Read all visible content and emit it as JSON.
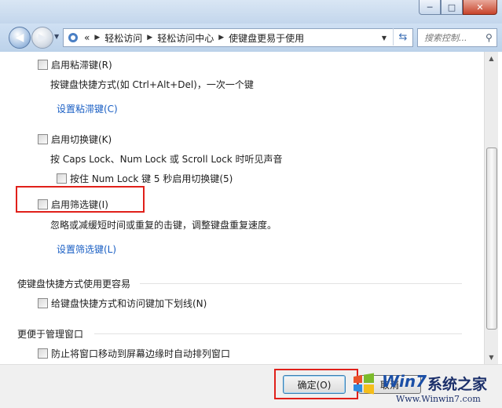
{
  "window": {
    "minimize": "─",
    "maximize": "□",
    "close": "✕"
  },
  "nav": {
    "back_icon": "back-arrow-icon",
    "forward_icon": "forward-arrow-icon",
    "address": {
      "overflow": "«",
      "crumbs": [
        "轻松访问",
        "轻松访问中心",
        "使键盘更易于使用"
      ]
    },
    "search_placeholder": "搜索控制...",
    "refresh_icon": "refresh-icon",
    "search_icon": "magnifier-icon"
  },
  "options": {
    "sticky": {
      "label": "启用粘滞键(R)",
      "desc": "按键盘快捷方式(如 Ctrl+Alt+Del)，一次一个键",
      "link": "设置粘滞键(C)"
    },
    "toggle": {
      "label": "启用切换键(K)",
      "desc": "按 Caps Lock、Num Lock 或 Scroll Lock 时听见声音",
      "sub_label": "按住 Num Lock 键 5 秒启用切换键(5)"
    },
    "filter": {
      "label": "启用筛选键(I)",
      "desc": "忽略或减缓短时间或重复的击键，调整键盘重复速度。",
      "link": "设置筛选键(L)"
    }
  },
  "sections": {
    "shortcuts": {
      "title": "使键盘快捷方式使用更容易",
      "option": "给键盘快捷方式和访问键加下划线(N)"
    },
    "windows": {
      "title": "更便于管理窗口",
      "option": "防止将窗口移动到屏幕边缘时自动排列窗口"
    }
  },
  "footer": {
    "ok": "确定(O)",
    "cancel": "取消"
  },
  "watermark": {
    "brand": "Win7",
    "cn": "系统之家",
    "url": "Www.Winwin7.com"
  },
  "colors": {
    "highlight": "#e0201a",
    "link": "#1a5fc4"
  }
}
